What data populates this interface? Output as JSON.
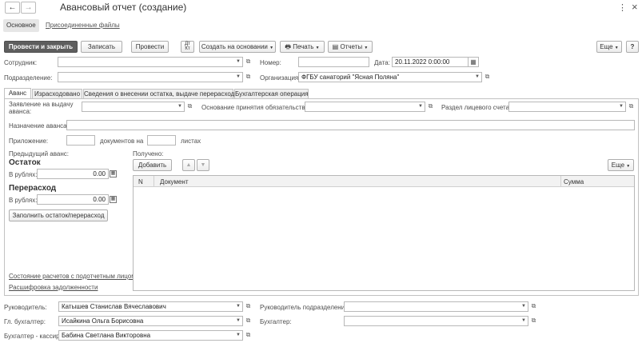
{
  "window": {
    "title": "Авансовый отчет (создание)",
    "more_menu": "⋮",
    "close": "×"
  },
  "top_tabs": [
    "Основное",
    "Присоединенные файлы"
  ],
  "toolbar": {
    "post_close": "Провести и закрыть",
    "save": "Записать",
    "post": "Провести",
    "create_based": "Создать на основании",
    "print": "Печать",
    "reports": "Отчеты",
    "more": "Еще",
    "help": "?"
  },
  "header": {
    "employee_label": "Сотрудник:",
    "employee_value": "",
    "number_label": "Номер:",
    "number_value": "",
    "date_label": "Дата:",
    "date_value": "20.11.2022  0:00:00",
    "department_label": "Подразделение:",
    "department_value": "",
    "organization_label": "Организация:",
    "organization_value": "ФГБУ санаторий \"Ясная Поляна\""
  },
  "inner_tabs": [
    "Аванс",
    "Израсходовано",
    "Сведения о внесении остатка, выдаче перерасхода",
    "Бухгалтерская операция"
  ],
  "advance": {
    "application_label": "Заявление на выдачу аванса:",
    "application_value": "",
    "obligation_label": "Основание принятия обязательства:",
    "obligation_value": "",
    "account_section_label": "Раздел лицевого счета:",
    "account_section_value": "",
    "purpose_label": "Назначение аванса:",
    "purpose_value": "",
    "attachment_label": "Приложение:",
    "attachment_docs_value": "",
    "docs_on_label": "документов на",
    "sheets_value": "",
    "sheets_label": "листах",
    "prev_advance_label": "Предыдущий аванс:",
    "balance_title": "Остаток",
    "rub_label": "В рублях:",
    "balance_value": "0.00",
    "overrun_title": "Перерасход",
    "overrun_value": "0.00",
    "fill_button": "Заполнить остаток/перерасход",
    "settlements_link": "Состояние расчетов с подотчетным лицом",
    "debt_link": "Расшифровка задолженности"
  },
  "received": {
    "label": "Получено:",
    "add_button": "Добавить",
    "up_icon": "▲",
    "down_icon": "▼",
    "more_button": "Еще",
    "columns": [
      "N",
      "Документ",
      "Сумма"
    ],
    "rows": []
  },
  "signatures": {
    "head_label": "Руководитель:",
    "head_value": "Катышев Станислав Вячеславович",
    "chief_acc_label": "Гл. бухгалтер:",
    "chief_acc_value": "Исайкина Ольга Борисовна",
    "cashier_label": "Бухгалтер - кассир:",
    "cashier_value": "Бабина Светлана Викторовна",
    "dept_head_label": "Руководитель подразделения:",
    "dept_head_value": "",
    "accountant_label": "Бухгалтер:",
    "accountant_value": ""
  }
}
